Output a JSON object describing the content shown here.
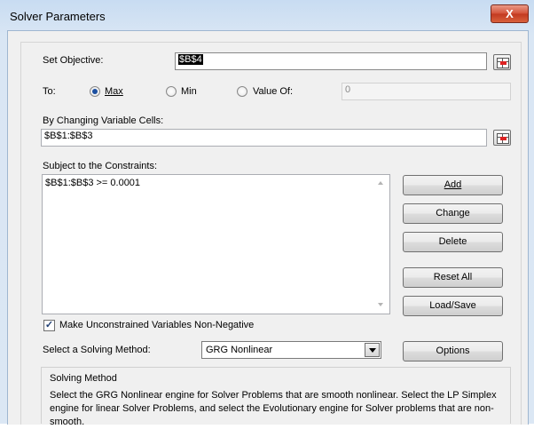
{
  "window": {
    "title": "Solver Parameters",
    "close_label": "X"
  },
  "objective": {
    "label": "Set Objective:",
    "value": "$B$4"
  },
  "to": {
    "label": "To:",
    "options": [
      {
        "label": "Max",
        "selected": true
      },
      {
        "label": "Min",
        "selected": false
      },
      {
        "label": "Value Of:",
        "selected": false
      }
    ],
    "value_of": "0"
  },
  "changing": {
    "label": "By Changing Variable Cells:",
    "value": "$B$1:$B$3"
  },
  "constraints": {
    "label": "Subject to the Constraints:",
    "items": [
      "$B$1:$B$3 >= 0.0001"
    ]
  },
  "buttons": {
    "add": "Add",
    "change": "Change",
    "delete": "Delete",
    "reset_all": "Reset All",
    "load_save": "Load/Save",
    "options": "Options"
  },
  "nonnegative": {
    "label": "Make Unconstrained Variables Non-Negative",
    "checked": true
  },
  "method": {
    "label": "Select a Solving Method:",
    "value": "GRG Nonlinear"
  },
  "solving_method": {
    "title": "Solving Method",
    "description": "Select the GRG Nonlinear engine for Solver Problems that are smooth nonlinear. Select the LP Simplex engine for linear Solver Problems, and select the Evolutionary engine for Solver problems that are non-smooth."
  },
  "colors": {
    "title_bar": "#c8dcf2",
    "close_button": "#c23a20",
    "selection": "#000000",
    "dialog_bg": "#f0f0f0"
  },
  "icons": {
    "close": "close-icon",
    "range_picker": "range-select-icon"
  }
}
